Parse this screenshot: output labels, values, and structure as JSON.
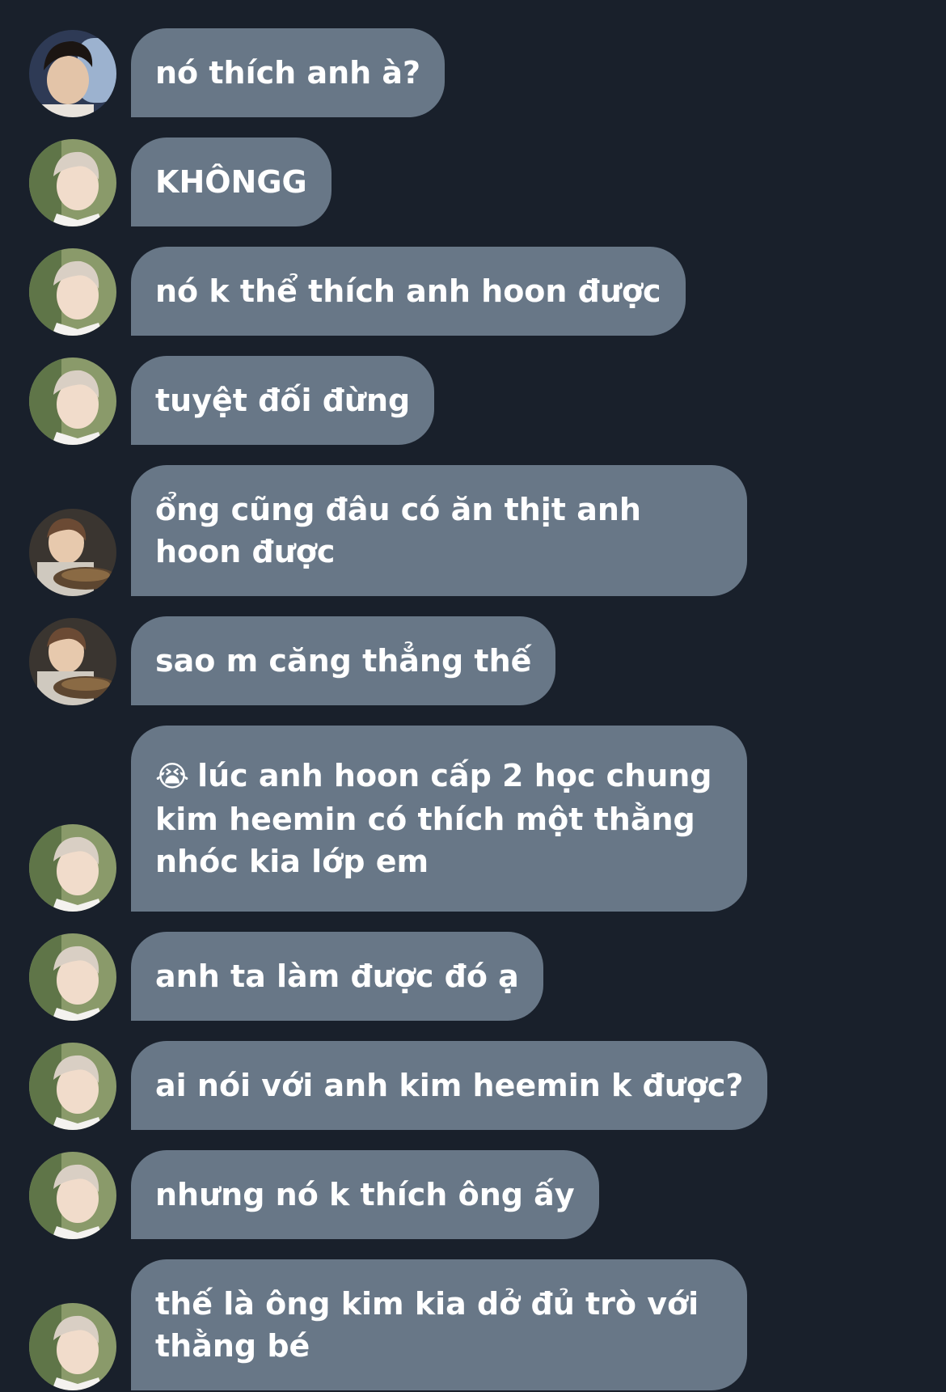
{
  "messages": [
    {
      "avatar": "avatar-a",
      "text": "nó thích anh à?"
    },
    {
      "avatar": "avatar-b",
      "text": "KHÔNGG"
    },
    {
      "avatar": "avatar-b",
      "text": "nó k thể thích anh hoon được"
    },
    {
      "avatar": "avatar-b",
      "text": "tuyệt đối đừng"
    },
    {
      "avatar": "avatar-c",
      "text": "ổng cũng đâu có ăn thịt anh hoon được"
    },
    {
      "avatar": "avatar-c",
      "text": "sao m căng thẳng thế"
    },
    {
      "avatar": "avatar-b",
      "emoji": "😭",
      "text": "lúc anh hoon cấp 2 học chung kim heemin có thích một thằng nhóc kia lớp em"
    },
    {
      "avatar": "avatar-b",
      "text": "anh ta làm được đó ạ"
    },
    {
      "avatar": "avatar-b",
      "text": "ai nói với anh kim heemin k được?"
    },
    {
      "avatar": "avatar-b",
      "text": "nhưng nó k thích ông ấy"
    },
    {
      "avatar": "avatar-b",
      "text": "thế là ông kim kia dở đủ trò với thằng bé"
    }
  ],
  "colors": {
    "background": "#19202b",
    "bubble": "#687787",
    "text": "#ffffff"
  }
}
